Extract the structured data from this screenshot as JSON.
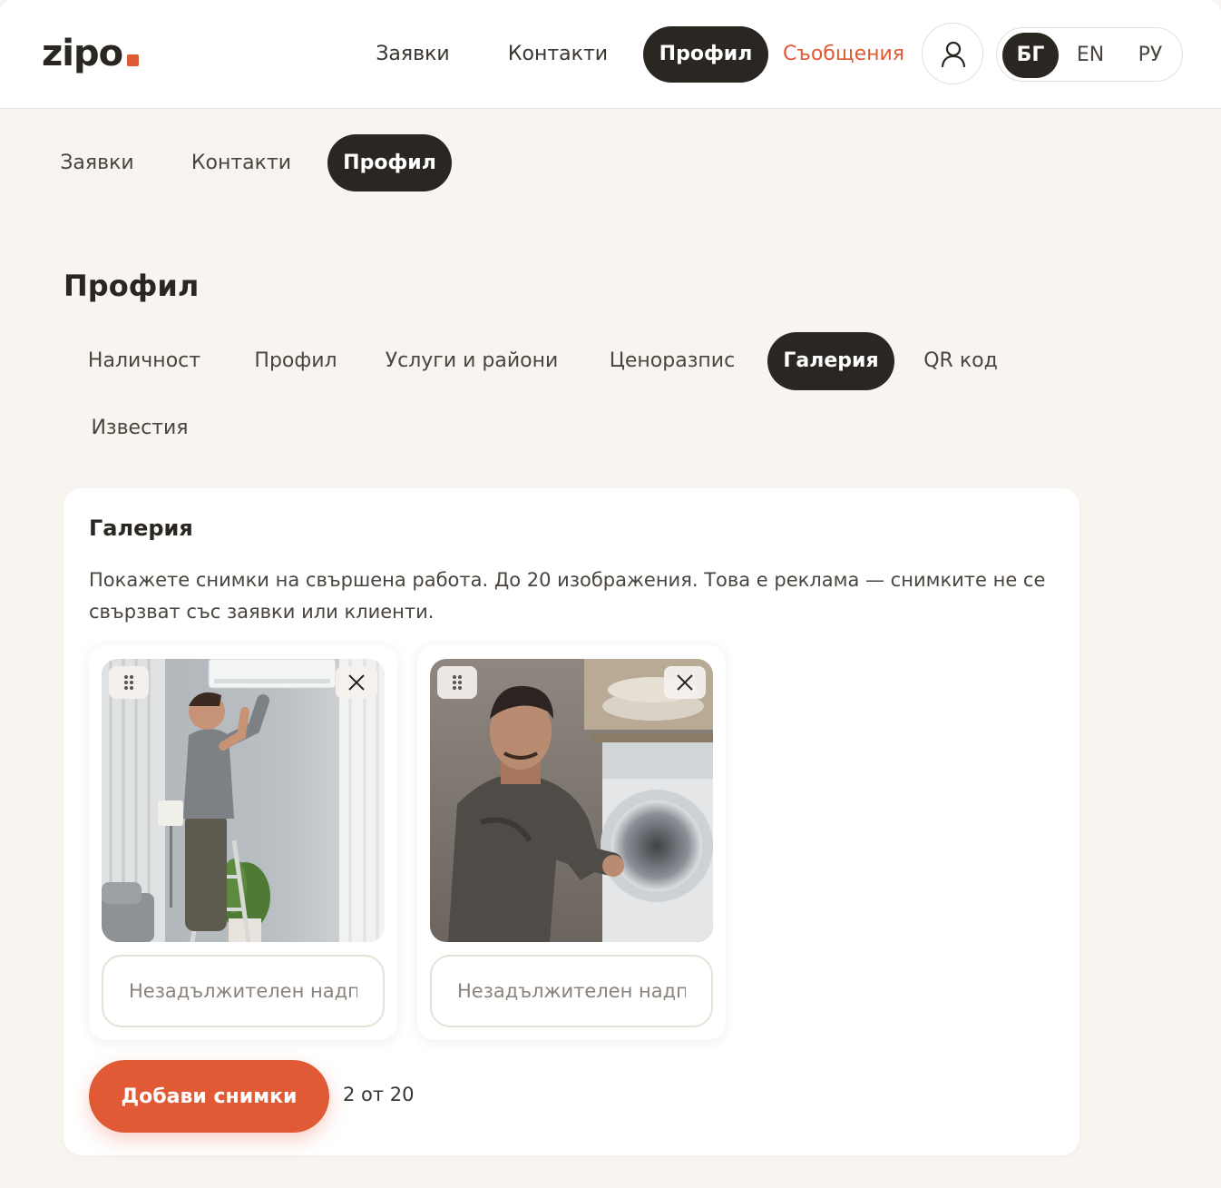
{
  "brand": {
    "name": "zipo",
    "accent_color": "#e05a35",
    "dark_color": "#2a2622"
  },
  "header": {
    "nav": [
      {
        "label": "Заявки",
        "active": false
      },
      {
        "label": "Контакти",
        "active": false
      },
      {
        "label": "Профил",
        "active": true
      },
      {
        "label": "Съобщения",
        "accent": true
      }
    ],
    "user_icon": "user-icon",
    "languages": [
      {
        "label": "БГ",
        "active": true
      },
      {
        "label": "EN",
        "active": false
      },
      {
        "label": "РУ",
        "active": false
      }
    ]
  },
  "subnav": [
    {
      "label": "Заявки",
      "active": false
    },
    {
      "label": "Контакти",
      "active": false
    },
    {
      "label": "Профил",
      "active": true
    }
  ],
  "page": {
    "title": "Профил"
  },
  "tabs": [
    {
      "label": "Наличност",
      "active": false
    },
    {
      "label": "Профил",
      "active": false
    },
    {
      "label": "Услуги и райони",
      "active": false
    },
    {
      "label": "Ценоразпис",
      "active": false
    },
    {
      "label": "Галерия",
      "active": true
    },
    {
      "label": "QR код",
      "active": false
    },
    {
      "label": "Известия",
      "active": false
    }
  ],
  "gallery": {
    "title": "Галерия",
    "description": "Покажете снимки на свършена работа. До 20 изображения. Това е реклама — снимките не се свързват със заявки или клиенти.",
    "photos": [
      {
        "alt": "Техник монтира климатик",
        "caption_value": "",
        "caption_placeholder": "Незадължителен надпис",
        "drag_icon": "drag-handle-icon",
        "remove_icon": "close-icon"
      },
      {
        "alt": "Техник ремонтира перална машина",
        "caption_value": "",
        "caption_placeholder": "Незадължителен надпис",
        "drag_icon": "drag-handle-icon",
        "remove_icon": "close-icon"
      }
    ],
    "add_button_label": "Добави снимки",
    "counter": "2 от 20"
  }
}
